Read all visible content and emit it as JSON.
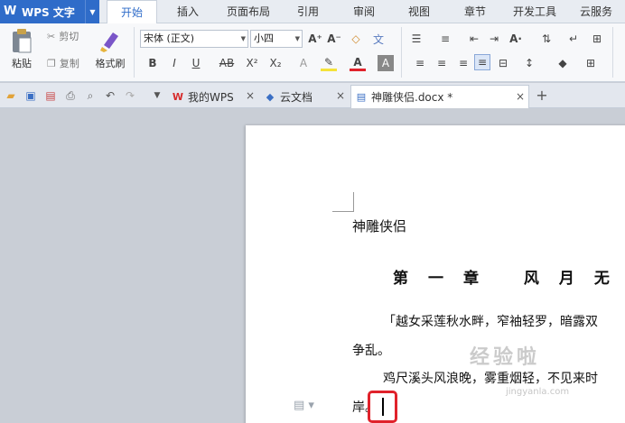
{
  "app": {
    "title": "WPS 文字",
    "logo": "W"
  },
  "menu": {
    "tabs": [
      {
        "label": "开始",
        "active": true
      },
      {
        "label": "插入"
      },
      {
        "label": "页面布局"
      },
      {
        "label": "引用"
      },
      {
        "label": "审阅"
      },
      {
        "label": "视图"
      },
      {
        "label": "章节"
      },
      {
        "label": "开发工具"
      },
      {
        "label": "云服务"
      }
    ]
  },
  "ribbon": {
    "paste": "粘贴",
    "cut": "剪切",
    "copy": "复制",
    "format_painter": "格式刷",
    "font_name": "宋体 (正文)",
    "font_size": "小四"
  },
  "doc_tabs": [
    {
      "label": "我的WPS",
      "icon": "wps-logo-icon"
    },
    {
      "label": "云文档",
      "icon": "cloud-cube-icon"
    },
    {
      "label": "神雕侠侣.docx *",
      "icon": "document-icon",
      "active": true
    }
  ],
  "document": {
    "title": "神雕侠侣",
    "chapter": "第一章 风月无",
    "para1_line1": "「越女采莲秋水畔，窄袖轻罗，暗露双",
    "para1_line2": "争乱。",
    "para2_line1": "鸡尺溪头风浪晚，雾重烟轻，不见来时",
    "para2_line2": "岸。"
  },
  "watermark": {
    "text": "经验啦",
    "url": "jingyanla.com"
  },
  "colors": {
    "brand": "#2f6cc9",
    "highlight": "#e0222b"
  }
}
